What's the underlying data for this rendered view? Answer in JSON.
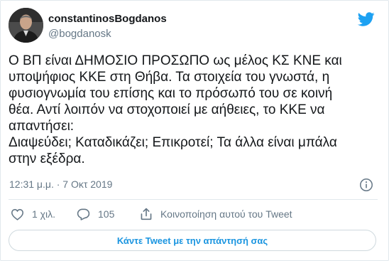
{
  "author": {
    "display_name": "constantinosBogdanos",
    "handle": "@bogdanosk"
  },
  "tweet": {
    "text_lines": [
      "Ο ΒΠ είναι ΔΗΜΟΣΙΟ ΠΡΟΣΩΠΟ ως μέλος ΚΣ ΚΝΕ και",
      "υποψήφιος ΚΚΕ στη Θήβα. Τα στοιχεία του γνωστά, η",
      "φυσιογνωμία του επίσης και το πρόσωπό του σε κοινή",
      "θέα. Αντί λοιπόν να στοχοποιεί με αήθειες, το ΚΚΕ να",
      "απαντήσει:",
      "Διαψεύδει; Καταδικάζει; Επικροτεί; Τα άλλα είναι μπάλα",
      "στην εξέδρα."
    ],
    "timestamp": "12:31 μ.μ. · 7 Οκτ 2019"
  },
  "actions": {
    "like_count": "1 χιλ.",
    "reply_count": "105",
    "share_label": "Κοινοποίηση αυτού του Tweet"
  },
  "reply_button_label": "Κάντε Tweet με την απάντησή σας",
  "colors": {
    "twitter_blue": "#1da1f2",
    "link_blue": "#1b95e0",
    "muted_text": "#657786",
    "border": "#e1e8ed"
  },
  "icons": [
    "twitter-bird-icon",
    "info-icon",
    "heart-icon",
    "reply-bubble-icon",
    "share-icon"
  ]
}
